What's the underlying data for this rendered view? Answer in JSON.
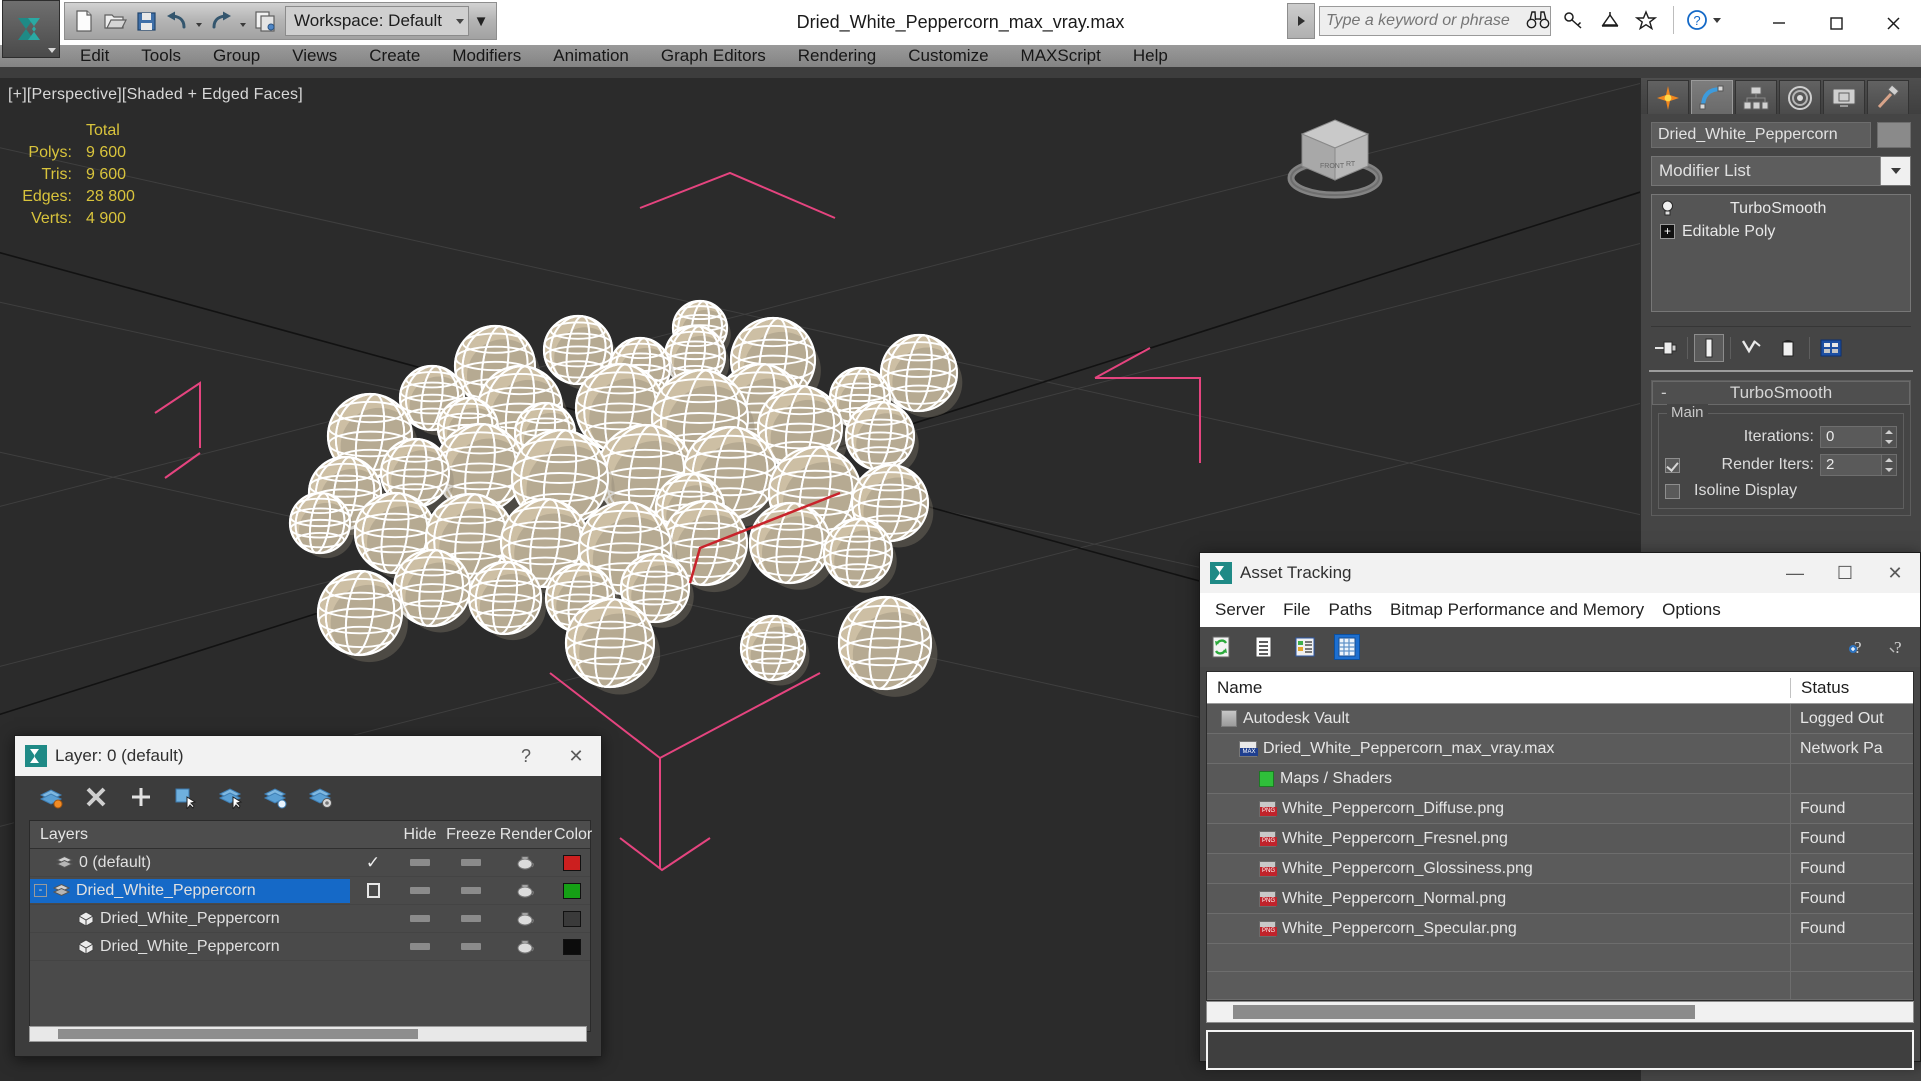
{
  "app": {
    "title": "Dried_White_Peppercorn_max_vray.max",
    "workspace_label": "Workspace: Default",
    "logo_icon": "autodesk-3dsmax-logo",
    "quick_access": [
      {
        "name": "new-file-button",
        "icon": "new-document-icon"
      },
      {
        "name": "open-file-button",
        "icon": "open-folder-icon"
      },
      {
        "name": "save-file-button",
        "icon": "floppy-disk-icon"
      },
      {
        "name": "undo-button",
        "icon": "undo-arrow-icon"
      },
      {
        "name": "redo-button",
        "icon": "redo-arrow-icon"
      },
      {
        "name": "project-folder-button",
        "icon": "project-folder-icon"
      }
    ],
    "search": {
      "placeholder": "Type a keyword or phrase"
    },
    "title_icons": [
      {
        "name": "search-binoculars-icon",
        "icon": "binoculars-icon"
      },
      {
        "name": "signin-key-icon",
        "icon": "key-icon"
      },
      {
        "name": "communication-center-icon",
        "icon": "satellite-dish-icon"
      },
      {
        "name": "favorites-star-icon",
        "icon": "star-icon"
      },
      {
        "name": "help-button",
        "icon": "question-circle-icon"
      }
    ],
    "window_buttons": [
      {
        "name": "minimize-button",
        "glyph": "—"
      },
      {
        "name": "maximize-button",
        "glyph": "☐"
      },
      {
        "name": "close-button",
        "glyph": "✕"
      }
    ]
  },
  "menubar": {
    "items": [
      "Edit",
      "Tools",
      "Group",
      "Views",
      "Create",
      "Modifiers",
      "Animation",
      "Graph Editors",
      "Rendering",
      "Customize",
      "MAXScript",
      "Help"
    ]
  },
  "viewport": {
    "label": "[+][Perspective][Shaded + Edged Faces]",
    "background": "#2b2b2b",
    "stats": {
      "header": "Total",
      "rows": [
        {
          "key": "Polys:",
          "value": "9 600"
        },
        {
          "key": "Tris:",
          "value": "9 600"
        },
        {
          "key": "Edges:",
          "value": "28 800"
        },
        {
          "key": "Verts:",
          "value": "4 900"
        }
      ]
    },
    "scene": {
      "object_color": "#cdbfa4",
      "wire_color": "#ffffff",
      "helper_color": "#e5447f",
      "grid_color": "#3a3a3a"
    }
  },
  "command_panel": {
    "tabs": [
      {
        "name": "create-tab",
        "icon": "star-burst-icon",
        "active": false
      },
      {
        "name": "modify-tab",
        "icon": "blue-arc-icon",
        "active": true
      },
      {
        "name": "hierarchy-tab",
        "icon": "hierarchy-icon",
        "active": false
      },
      {
        "name": "motion-tab",
        "icon": "motion-wheel-icon",
        "active": false
      },
      {
        "name": "display-tab",
        "icon": "monitor-icon",
        "active": false
      },
      {
        "name": "utilities-tab",
        "icon": "hammer-icon",
        "active": false
      }
    ],
    "object_name": "Dried_White_Peppercorn",
    "modifier_list_label": "Modifier List",
    "modifier_stack": [
      {
        "label": "TurboSmooth",
        "icon": "lightbulb-icon",
        "selected": true
      },
      {
        "label": "Editable Poly",
        "icon": "plus-box-icon",
        "selected": false
      }
    ],
    "stack_tools": [
      {
        "name": "pin-stack-button",
        "icon": "pin-icon"
      },
      {
        "name": "show-end-result-button",
        "icon": "show-end-result-icon"
      },
      {
        "name": "make-unique-button",
        "icon": "make-unique-icon"
      },
      {
        "name": "remove-modifier-button",
        "icon": "trash-icon"
      },
      {
        "name": "configure-modifier-sets-button",
        "icon": "configure-sets-icon"
      }
    ],
    "rollout": {
      "minus_glyph": "-",
      "title": "TurboSmooth",
      "group_title": "Main",
      "iterations_label": "Iterations:",
      "iterations_value": "0",
      "render_iters_label": "Render Iters:",
      "render_iters_value": "2",
      "render_iters_checked": true,
      "isoline_label": "Isoline Display",
      "isoline_checked": false
    }
  },
  "layer_dialog": {
    "title": "Layer: 0 (default)",
    "icon": "3dsmax-small-icon",
    "help_glyph": "?",
    "close_glyph": "✕",
    "toolbar": [
      {
        "name": "create-new-layer-button",
        "icon": "new-layer-icon"
      },
      {
        "name": "delete-layer-button",
        "icon": "delete-x-icon"
      },
      {
        "name": "add-layer-button",
        "icon": "plus-icon"
      },
      {
        "name": "select-objects-in-layer-button",
        "icon": "select-objects-icon"
      },
      {
        "name": "select-highlighted-layer-button",
        "icon": "select-layer-icon"
      },
      {
        "name": "highlight-selected-objects-button",
        "icon": "highlight-objects-icon"
      },
      {
        "name": "layer-settings-button",
        "icon": "layer-settings-icon"
      }
    ],
    "columns": [
      "Layers",
      "",
      "Hide",
      "Freeze",
      "Render",
      "Color"
    ],
    "rows": [
      {
        "name": "0 (default)",
        "indent": 0,
        "icon": "layer-stack-icon",
        "expander": "",
        "current": "✓",
        "hide": "dash",
        "freeze": "dash",
        "render": "teapot",
        "color": "#cc1f1f",
        "selected": false
      },
      {
        "name": "Dried_White_Peppercorn",
        "indent": 0,
        "icon": "layer-stack-icon",
        "expander": "-",
        "current": "box",
        "hide": "dash",
        "freeze": "dash",
        "render": "teapot",
        "color": "#15a015",
        "selected": true
      },
      {
        "name": "Dried_White_Peppercorn",
        "indent": 1,
        "icon": "object-box-icon",
        "expander": "",
        "current": "",
        "hide": "dash",
        "freeze": "dash",
        "render": "teapot",
        "color": "#3a3a3a",
        "selected": false
      },
      {
        "name": "Dried_White_Peppercorn",
        "indent": 1,
        "icon": "object-box-icon",
        "expander": "",
        "current": "",
        "hide": "dash",
        "freeze": "dash",
        "render": "teapot",
        "color": "#0c0c0c",
        "selected": false
      }
    ]
  },
  "asset_tracking": {
    "title": "Asset Tracking",
    "icon": "3dsmax-small-icon",
    "window_buttons": [
      {
        "name": "asset-minimize-button",
        "glyph": "—"
      },
      {
        "name": "asset-maximize-button",
        "glyph": "☐"
      },
      {
        "name": "asset-close-button",
        "glyph": "✕"
      }
    ],
    "menu": [
      "Server",
      "File",
      "Paths",
      "Bitmap Performance and Memory",
      "Options"
    ],
    "toolbar": [
      {
        "name": "refresh-button",
        "icon": "refresh-icon",
        "active": false
      },
      {
        "name": "list-view-button",
        "icon": "list-lines-icon",
        "active": false
      },
      {
        "name": "detail-view-button",
        "icon": "detail-view-icon",
        "active": false
      },
      {
        "name": "grid-view-button",
        "icon": "grid-table-icon",
        "active": true
      }
    ],
    "toolbar_right": [
      {
        "name": "help-add-button",
        "icon": "help-plus-icon"
      },
      {
        "name": "help-question-button",
        "icon": "help-question-icon"
      }
    ],
    "columns": [
      "Name",
      "Status"
    ],
    "rows": [
      {
        "name": "Autodesk Vault",
        "status": "Logged Out",
        "indent": 1,
        "icon": "vault-icon"
      },
      {
        "name": "Dried_White_Peppercorn_max_vray.max",
        "status": "Network Pa",
        "indent": 2,
        "icon": "max-file-icon"
      },
      {
        "name": "Maps / Shaders",
        "status": "",
        "indent": 3,
        "icon": "maps-shaders-icon"
      },
      {
        "name": "White_Peppercorn_Diffuse.png",
        "status": "Found",
        "indent": 3,
        "icon": "png-file-icon"
      },
      {
        "name": "White_Peppercorn_Fresnel.png",
        "status": "Found",
        "indent": 3,
        "icon": "png-file-icon"
      },
      {
        "name": "White_Peppercorn_Glossiness.png",
        "status": "Found",
        "indent": 3,
        "icon": "png-file-icon"
      },
      {
        "name": "White_Peppercorn_Normal.png",
        "status": "Found",
        "indent": 3,
        "icon": "png-file-icon"
      },
      {
        "name": "White_Peppercorn_Specular.png",
        "status": "Found",
        "indent": 3,
        "icon": "png-file-icon"
      }
    ]
  }
}
